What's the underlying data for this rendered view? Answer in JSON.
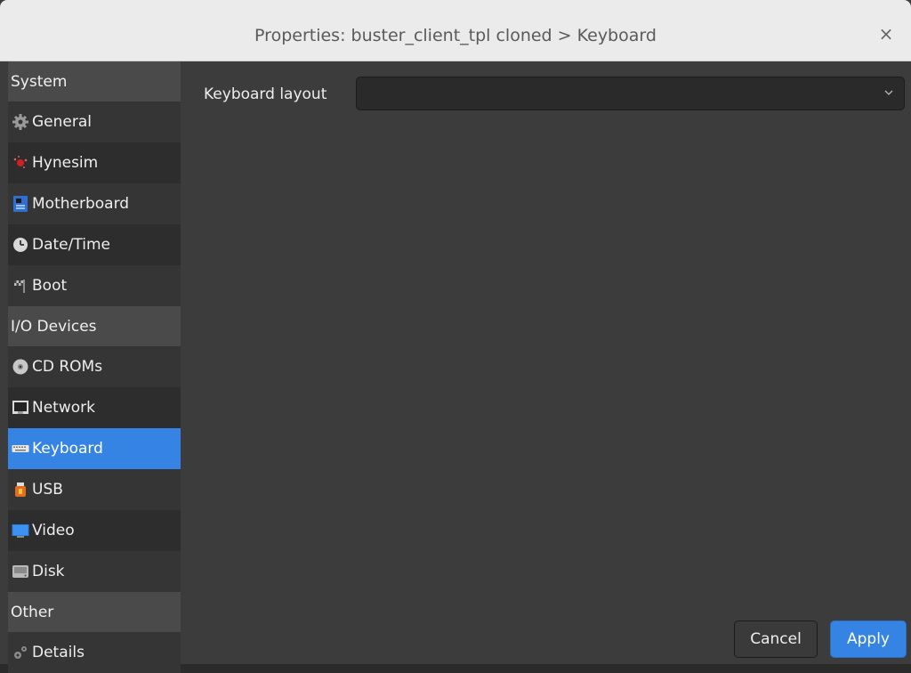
{
  "window": {
    "title": "Properties: buster_client_tpl cloned > Keyboard",
    "close_glyph": "×"
  },
  "sidebar": {
    "sections": [
      {
        "label": "System"
      },
      {
        "label": "I/O Devices"
      },
      {
        "label": "Other"
      }
    ],
    "items": [
      {
        "label": "General",
        "icon": "gear-icon"
      },
      {
        "label": "Hynesim",
        "icon": "hynesim-icon"
      },
      {
        "label": "Motherboard",
        "icon": "motherboard-icon"
      },
      {
        "label": "Date/Time",
        "icon": "clock-icon"
      },
      {
        "label": "Boot",
        "icon": "boot-flag-icon"
      },
      {
        "label": "CD ROMs",
        "icon": "cd-icon"
      },
      {
        "label": "Network",
        "icon": "network-icon"
      },
      {
        "label": "Keyboard",
        "icon": "keyboard-icon",
        "selected": true
      },
      {
        "label": "USB",
        "icon": "usb-icon"
      },
      {
        "label": "Video",
        "icon": "monitor-icon"
      },
      {
        "label": "Disk",
        "icon": "disk-icon"
      },
      {
        "label": "Details",
        "icon": "details-gear-icon"
      }
    ]
  },
  "main": {
    "keyboard_layout_label": "Keyboard layout",
    "keyboard_layout_value": ""
  },
  "buttons": {
    "cancel": "Cancel",
    "apply": "Apply"
  },
  "colors": {
    "accent": "#3584e4",
    "background": "#3c3c3c",
    "titlebar": "#ebebeb"
  }
}
